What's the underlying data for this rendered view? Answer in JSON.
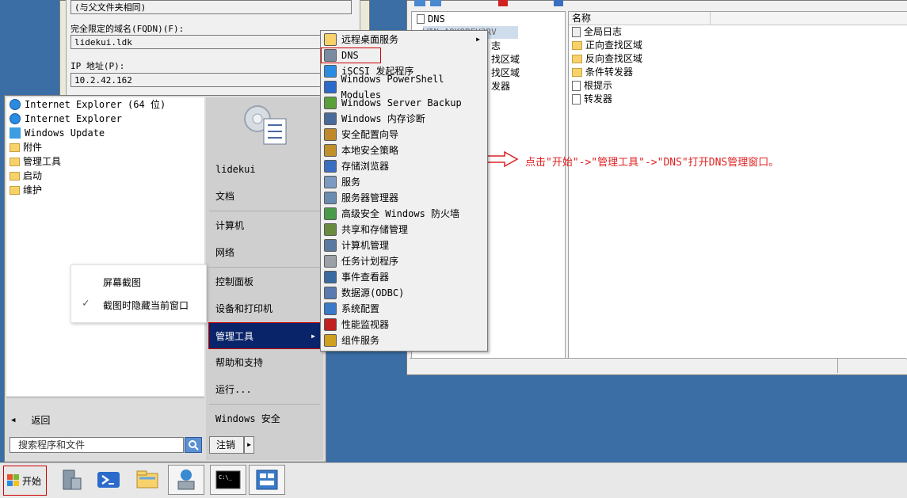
{
  "properties_dialog": {
    "parent_folder_note": "(与父文件夹相同)",
    "fqdn_label": "完全限定的域名(FQDN)(F):",
    "fqdn_value": "lidekui.ldk",
    "ip_label": "IP 地址(P):",
    "ip_value": "10.2.42.162"
  },
  "dns_manager": {
    "tree": {
      "root": "DNS",
      "server": "WIN-A9K8BEV3RV",
      "items": [
        "志",
        "找区域",
        "找区域",
        "发器"
      ]
    },
    "list_header": {
      "name": "名称"
    },
    "list_items": [
      {
        "label": "全局日志",
        "icon": "log-icon"
      },
      {
        "label": "正向查找区域",
        "icon": "folder-icon"
      },
      {
        "label": "反向查找区域",
        "icon": "folder-icon"
      },
      {
        "label": "条件转发器",
        "icon": "folder-icon"
      },
      {
        "label": "根提示",
        "icon": "doc-icon"
      },
      {
        "label": "转发器",
        "icon": "doc-icon"
      }
    ]
  },
  "start_menu": {
    "programs": [
      {
        "label": "Internet Explorer (64 位)",
        "icon": "ie-icon"
      },
      {
        "label": "Internet Explorer",
        "icon": "ie-icon"
      },
      {
        "label": "Windows Update",
        "icon": "windows-update-icon"
      },
      {
        "label": "附件",
        "icon": "folder-icon"
      },
      {
        "label": "管理工具",
        "icon": "folder-icon"
      },
      {
        "label": "启动",
        "icon": "folder-icon"
      },
      {
        "label": "维护",
        "icon": "folder-icon"
      }
    ],
    "back_label": "返回",
    "search_placeholder": "搜索程序和文件",
    "right_items": {
      "user": "lidekui",
      "documents": "文档",
      "computer": "计算机",
      "network": "网络",
      "control_panel": "控制面板",
      "devices": "设备和打印机",
      "admin_tools": "管理工具",
      "help": "帮助和支持",
      "run": "运行...",
      "security": "Windows 安全",
      "logoff": "注销"
    }
  },
  "admin_submenu": {
    "items": [
      {
        "label": "远程桌面服务",
        "icon": "folder-icon",
        "has_arrow": true
      },
      {
        "label": "DNS",
        "icon": "dns-icon"
      },
      {
        "label": "iSCSI 发起程序",
        "icon": "iscsi-icon"
      },
      {
        "label": "Windows PowerShell Modules",
        "icon": "powershell-icon"
      },
      {
        "label": "Windows Server Backup",
        "icon": "backup-icon"
      },
      {
        "label": "Windows 内存诊断",
        "icon": "memory-icon"
      },
      {
        "label": "安全配置向导",
        "icon": "security-wizard-icon"
      },
      {
        "label": "本地安全策略",
        "icon": "policy-icon"
      },
      {
        "label": "存储浏览器",
        "icon": "storage-icon"
      },
      {
        "label": "服务",
        "icon": "services-icon"
      },
      {
        "label": "服务器管理器",
        "icon": "server-manager-icon"
      },
      {
        "label": "高级安全 Windows 防火墙",
        "icon": "firewall-icon"
      },
      {
        "label": "共享和存储管理",
        "icon": "share-icon"
      },
      {
        "label": "计算机管理",
        "icon": "computer-management-icon"
      },
      {
        "label": "任务计划程序",
        "icon": "scheduler-icon"
      },
      {
        "label": "事件查看器",
        "icon": "event-viewer-icon"
      },
      {
        "label": "数据源(ODBC)",
        "icon": "odbc-icon"
      },
      {
        "label": "系统配置",
        "icon": "sysconfig-icon"
      },
      {
        "label": "性能监视器",
        "icon": "perfmon-icon"
      },
      {
        "label": "组件服务",
        "icon": "component-icon"
      }
    ]
  },
  "snip_popup": {
    "screenshot": "屏幕截图",
    "hide_window": "截图时隐藏当前窗口"
  },
  "annotation": "点击\"开始\"->\"管理工具\"->\"DNS\"打开DNS管理窗口。",
  "taskbar": {
    "start_label": "开始",
    "buttons": [
      "server-manager-icon",
      "powershell-icon",
      "explorer-icon",
      "network-icon",
      "cmd-icon",
      "control-icon"
    ]
  },
  "colors": {
    "desktop": "#3a6ea5",
    "highlight": "#0a246a",
    "annotation_red": "#e02020"
  }
}
